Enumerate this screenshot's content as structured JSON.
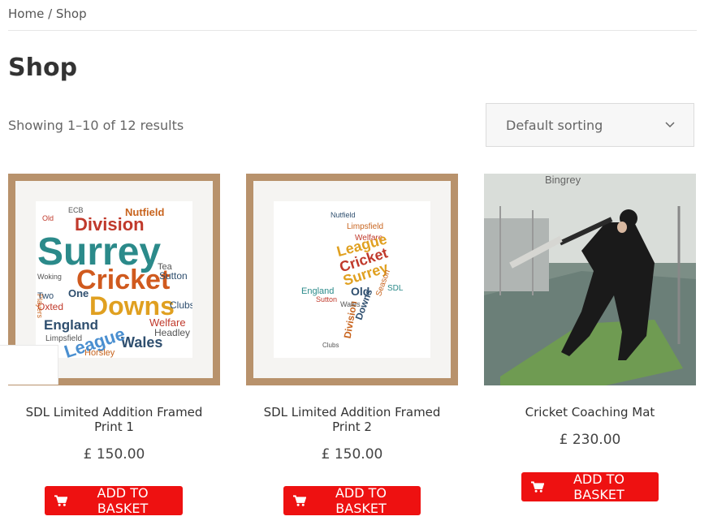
{
  "breadcrumb": {
    "home": "Home",
    "separator": " / ",
    "current": "Shop"
  },
  "page_title": "Shop",
  "result_count": "Showing 1–10 of 12 results",
  "sorting": {
    "selected": "Default sorting"
  },
  "colors": {
    "button": "#ee1111",
    "frame": "#b8926c"
  },
  "products": [
    {
      "name": "SDL Limited Addition Framed Print 1",
      "price": "£ 150.00",
      "button": "ADD TO BASKET"
    },
    {
      "name": "SDL Limited Addition Framed Print 2",
      "price": "£ 150.00",
      "button": "ADD TO BASKET"
    },
    {
      "name": "Cricket Coaching Mat",
      "price": "£ 230.00",
      "button": "ADD TO BASKET"
    }
  ],
  "wordcloud_1": [
    "Surrey",
    "Cricket",
    "Downs",
    "Division",
    "League",
    "England",
    "Wales",
    "Nutfield",
    "Sutton",
    "Clubs",
    "Oxted",
    "Headley",
    "Welfare",
    "Horsley",
    "Limpsfield",
    "Two",
    "One",
    "ECB",
    "Old",
    "Players",
    "Woking",
    "Tea"
  ],
  "wordcloud_2": [
    "Surrey",
    "Cricket",
    "League",
    "Downs",
    "Division",
    "Old",
    "England",
    "Wales",
    "Season",
    "SDL",
    "Welfare",
    "Nutfield",
    "Limpsfield",
    "Sutton",
    "Clubs"
  ]
}
